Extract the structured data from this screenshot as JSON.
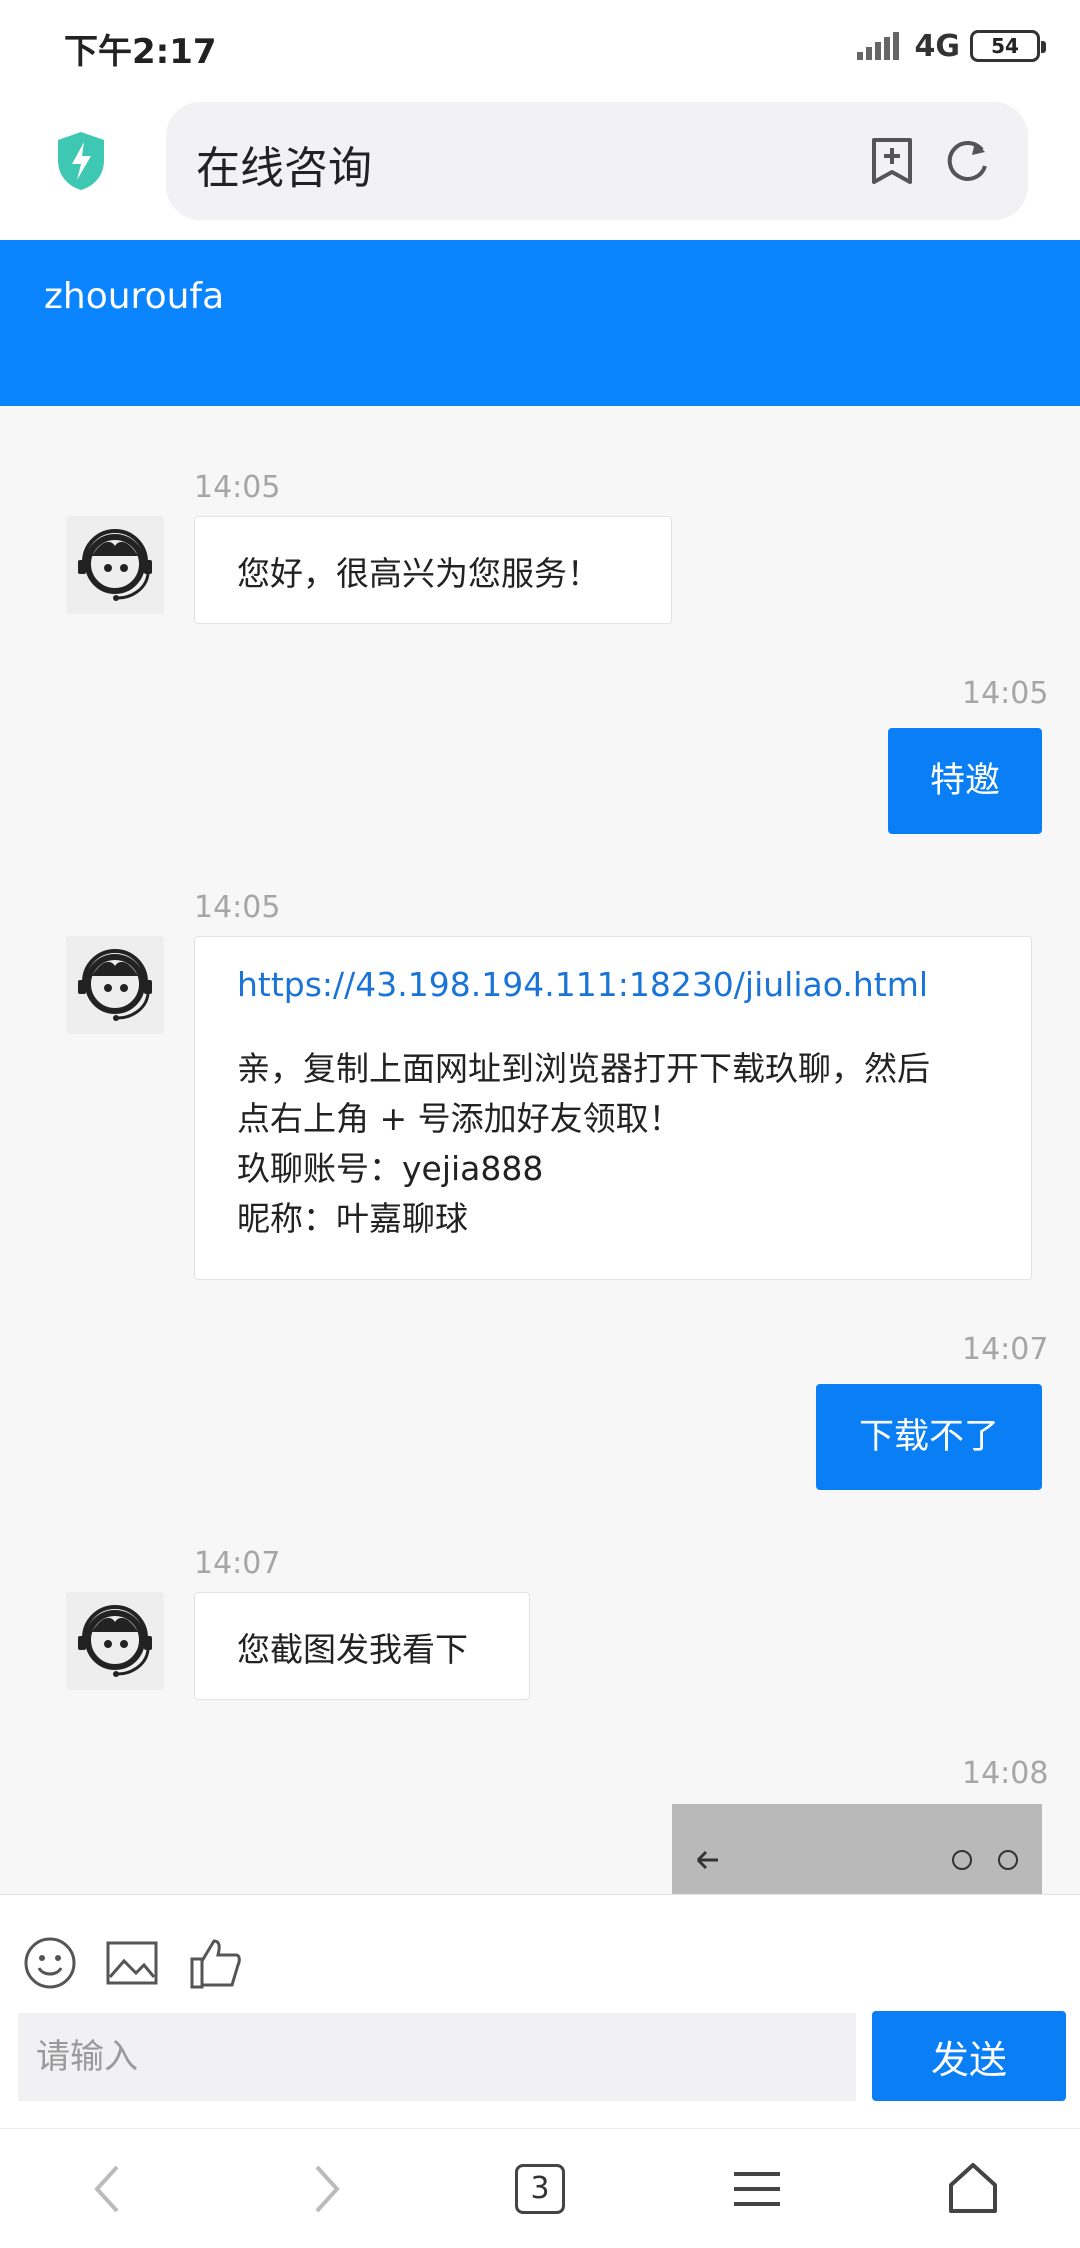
{
  "status_bar": {
    "time": "下午2:17",
    "network": "4G",
    "battery": "54"
  },
  "browser": {
    "page_title": "在线咨询",
    "tab_count": "3"
  },
  "chat": {
    "agent_name": "zhouroufa",
    "messages": [
      {
        "time": "14:05",
        "text": "您好，很高兴为您服务！"
      },
      {
        "time": "14:05",
        "text": "特邀"
      },
      {
        "time": "14:05",
        "link": "https://43.198.194.111:18230/jiuliao.html",
        "lines": [
          "亲，复制上面网址到浏览器打开下载玖聊，然后",
          "点右上角 + 号添加好友领取！",
          "玖聊账号：yejia888",
          "昵称：叶嘉聊球"
        ]
      },
      {
        "time": "14:07",
        "text": "下载不了"
      },
      {
        "time": "14:07",
        "text": "您截图发我看下"
      },
      {
        "time": "14:08"
      }
    ]
  },
  "input": {
    "placeholder": "请输入",
    "send_label": "发送"
  },
  "icons": {
    "accent": "#0a84ff",
    "shield_color": "#3ec7b3"
  }
}
